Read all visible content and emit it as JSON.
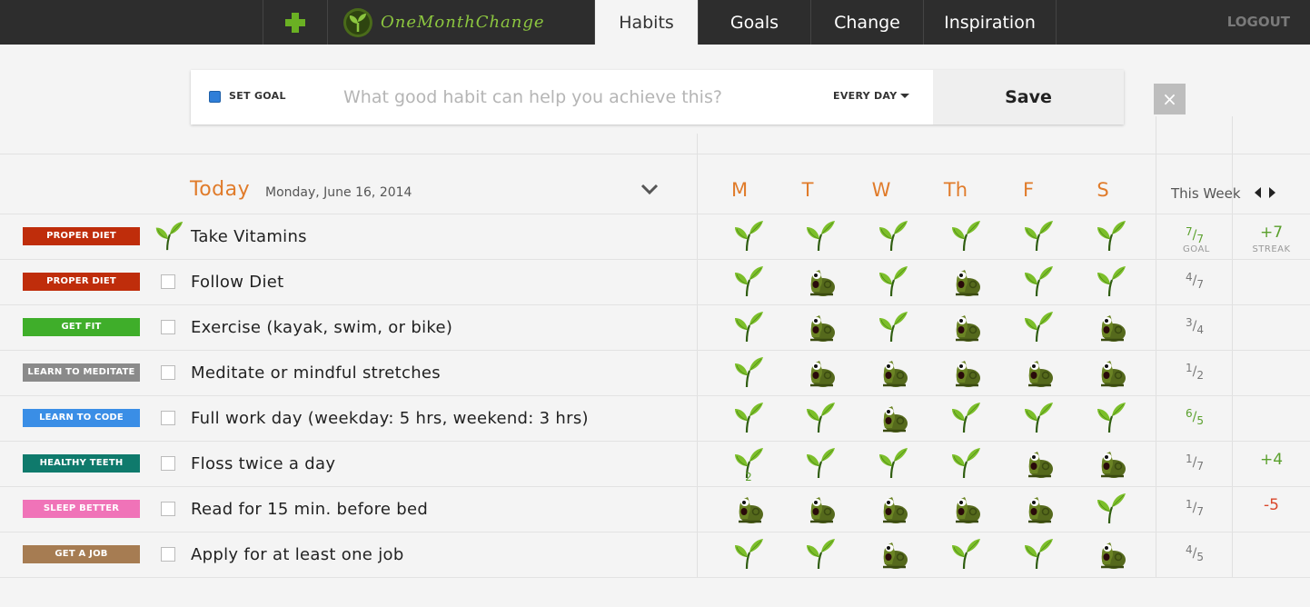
{
  "nav": {
    "logo_text": "OneMonthChange",
    "tabs": [
      "Habits",
      "Goals",
      "Change",
      "Inspiration"
    ],
    "active_tab": "Habits",
    "logout_label": "LOGOUT"
  },
  "goal_form": {
    "set_goal_label": "SET GOAL",
    "habit_placeholder": "What good habit can help you achieve this?",
    "frequency_label": "EVERY DAY",
    "save_label": "Save",
    "close_label": "×"
  },
  "header": {
    "today_label": "Today",
    "date": "Monday, June 16, 2014",
    "days": [
      "M",
      "T",
      "W",
      "Th",
      "F",
      "S"
    ],
    "week_label": "This Week"
  },
  "colors": {
    "accent_orange": "#e07b2a",
    "sprout_green": "#5aa02c",
    "streak_red": "#d9472b"
  },
  "habits": [
    {
      "tag": "PROPER DIET",
      "tag_color": "#bf2d0b",
      "name": "Take Vitamins",
      "done_today": true,
      "days": [
        "sprout",
        "sprout",
        "sprout",
        "sprout",
        "sprout",
        "sprout"
      ],
      "day_counts": [
        "",
        "",
        "",
        "",
        "",
        ""
      ],
      "goal_num": "7",
      "goal_den": "7",
      "goal_met": true,
      "goal_sub": "GOAL",
      "streak": "+7",
      "streak_sign": "pos",
      "streak_sub": "STREAK"
    },
    {
      "tag": "PROPER DIET",
      "tag_color": "#bf2d0b",
      "name": "Follow Diet",
      "done_today": false,
      "days": [
        "sprout",
        "slug",
        "sprout",
        "slug",
        "sprout",
        "sprout"
      ],
      "day_counts": [
        "",
        "",
        "",
        "",
        "",
        ""
      ],
      "goal_num": "4",
      "goal_den": "7",
      "goal_met": false,
      "goal_sub": "",
      "streak": "",
      "streak_sign": "",
      "streak_sub": ""
    },
    {
      "tag": "GET FIT",
      "tag_color": "#3fae2a",
      "name": "Exercise (kayak, swim, or bike)",
      "done_today": false,
      "days": [
        "sprout",
        "slug",
        "sprout",
        "slug",
        "sprout",
        "slug"
      ],
      "day_counts": [
        "",
        "",
        "",
        "",
        "",
        ""
      ],
      "goal_num": "3",
      "goal_den": "4",
      "goal_met": false,
      "goal_sub": "",
      "streak": "",
      "streak_sign": "",
      "streak_sub": ""
    },
    {
      "tag": "LEARN TO MEDITATE",
      "tag_color": "#8a8a8a",
      "name": "Meditate or mindful stretches",
      "done_today": false,
      "days": [
        "sprout",
        "slug",
        "slug",
        "slug",
        "slug",
        "slug"
      ],
      "day_counts": [
        "",
        "",
        "",
        "",
        "",
        ""
      ],
      "goal_num": "1",
      "goal_den": "2",
      "goal_met": false,
      "goal_sub": "",
      "streak": "",
      "streak_sign": "",
      "streak_sub": ""
    },
    {
      "tag": "LEARN TO CODE",
      "tag_color": "#3a8ee6",
      "name": "Full work day (weekday: 5 hrs, weekend: 3 hrs)",
      "done_today": false,
      "days": [
        "sprout",
        "sprout",
        "slug",
        "sprout",
        "sprout",
        "sprout"
      ],
      "day_counts": [
        "",
        "",
        "",
        "",
        "",
        ""
      ],
      "goal_num": "6",
      "goal_den": "5",
      "goal_met": true,
      "goal_sub": "",
      "streak": "",
      "streak_sign": "",
      "streak_sub": ""
    },
    {
      "tag": "HEALTHY TEETH",
      "tag_color": "#0f7a6c",
      "name": "Floss twice a day",
      "done_today": false,
      "days": [
        "sprout",
        "sprout",
        "sprout",
        "sprout",
        "slug",
        "slug"
      ],
      "day_counts": [
        "2",
        "",
        "",
        "",
        "",
        ""
      ],
      "goal_num": "1",
      "goal_den": "7",
      "goal_met": false,
      "goal_sub": "",
      "streak": "+4",
      "streak_sign": "pos",
      "streak_sub": ""
    },
    {
      "tag": "SLEEP BETTER",
      "tag_color": "#f073b8",
      "name": "Read for 15 min. before bed",
      "done_today": false,
      "days": [
        "slug",
        "slug",
        "slug",
        "slug",
        "slug",
        "sprout"
      ],
      "day_counts": [
        "",
        "",
        "",
        "",
        "",
        ""
      ],
      "goal_num": "1",
      "goal_den": "7",
      "goal_met": false,
      "goal_sub": "",
      "streak": "-5",
      "streak_sign": "neg",
      "streak_sub": ""
    },
    {
      "tag": "GET A JOB",
      "tag_color": "#a67c52",
      "name": "Apply for at least one job",
      "done_today": false,
      "days": [
        "sprout",
        "sprout",
        "slug",
        "sprout",
        "sprout",
        "slug"
      ],
      "day_counts": [
        "",
        "",
        "",
        "",
        "",
        ""
      ],
      "goal_num": "4",
      "goal_den": "5",
      "goal_met": false,
      "goal_sub": "",
      "streak": "",
      "streak_sign": "",
      "streak_sub": ""
    }
  ]
}
